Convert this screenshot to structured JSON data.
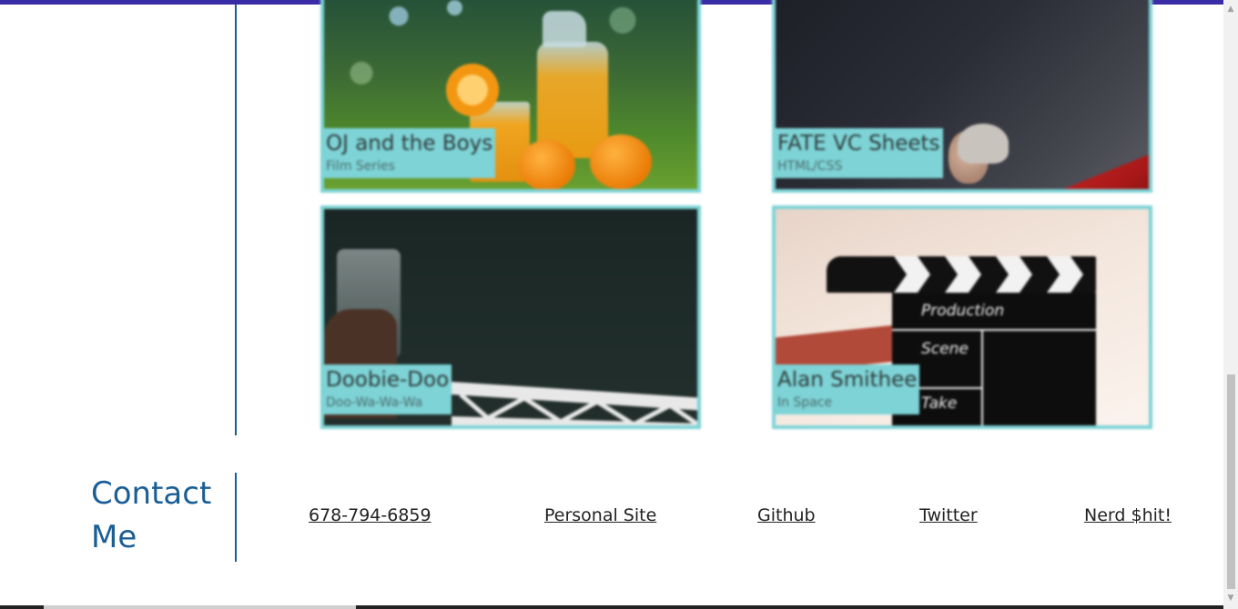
{
  "portfolio": {
    "items": [
      {
        "title": "OJ and the Boys",
        "subtitle": "Film Series"
      },
      {
        "title": "FATE VC Sheets",
        "subtitle": "HTML/CSS"
      },
      {
        "title": "Doobie-Doo",
        "subtitle": "Doo-Wa-Wa-Wa"
      },
      {
        "title": "Alan Smithee",
        "subtitle": "In Space"
      }
    ],
    "clapperboard_labels": [
      "Production",
      "Scene",
      "Take"
    ]
  },
  "contact": {
    "heading": "Contact Me",
    "links": {
      "phone": "678-794-6859",
      "personal_site": "Personal Site",
      "github": "Github",
      "twitter": "Twitter",
      "nerd": "Nerd $hit!"
    }
  },
  "colors": {
    "accent": "#1a5e96",
    "card_border": "#7dd3d6",
    "top_bar": "#3a2ca6"
  },
  "scrollbar": {
    "up_icon": "chevron-up-icon",
    "down_icon": "chevron-down-icon"
  }
}
